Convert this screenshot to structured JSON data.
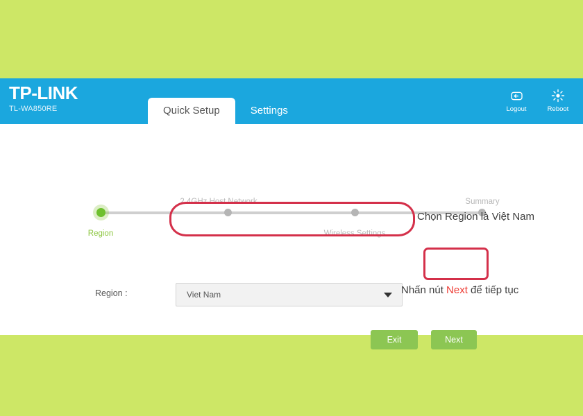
{
  "colors": {
    "page_background": "#cde766",
    "header_blue": "#1ba7de",
    "panel_white": "#ffffff",
    "button_green": "#8cc653",
    "active_step_green": "#6ec02e",
    "annotation_red": "#d4304a",
    "accent_red": "#ee3b33",
    "inactive_gray": "#b9b9b9"
  },
  "header": {
    "brand": "TP-LINK",
    "model": "TL-WA850RE",
    "tabs": [
      {
        "label": "Quick Setup",
        "active": true
      },
      {
        "label": "Settings",
        "active": false
      }
    ],
    "actions": [
      {
        "label": "Logout",
        "icon": "logout-icon"
      },
      {
        "label": "Reboot",
        "icon": "reboot-icon"
      }
    ]
  },
  "stepper": {
    "steps": [
      {
        "label": "Region",
        "position": "below",
        "active": true
      },
      {
        "label": "2.4GHz Host Network",
        "position": "above",
        "active": false
      },
      {
        "label": "Wireless Settings",
        "position": "below",
        "active": false
      },
      {
        "label": "Summary",
        "position": "above",
        "active": false
      }
    ]
  },
  "form": {
    "region_label": "Region :",
    "region_value": "Viet Nam",
    "caret_icon": "chevron-down-icon"
  },
  "buttons": {
    "exit": "Exit",
    "next": "Next"
  },
  "annotations": {
    "region_note": "Chọn Region là Việt Nam",
    "next_note_prefix": "Nhấn nút ",
    "next_note_accent": "Next",
    "next_note_suffix": " để tiếp tục"
  }
}
